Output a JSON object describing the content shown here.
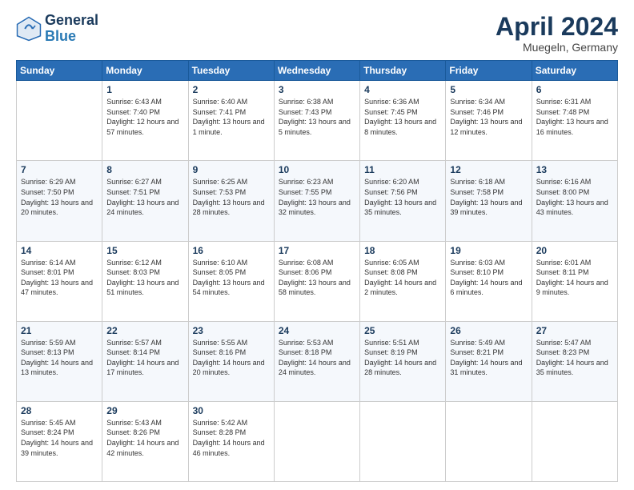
{
  "header": {
    "logo_line1": "General",
    "logo_line2": "Blue",
    "title": "April 2024",
    "subtitle": "Muegeln, Germany"
  },
  "weekdays": [
    "Sunday",
    "Monday",
    "Tuesday",
    "Wednesday",
    "Thursday",
    "Friday",
    "Saturday"
  ],
  "weeks": [
    [
      {
        "day": "",
        "info": ""
      },
      {
        "day": "1",
        "info": "Sunrise: 6:43 AM\nSunset: 7:40 PM\nDaylight: 12 hours\nand 57 minutes."
      },
      {
        "day": "2",
        "info": "Sunrise: 6:40 AM\nSunset: 7:41 PM\nDaylight: 13 hours\nand 1 minute."
      },
      {
        "day": "3",
        "info": "Sunrise: 6:38 AM\nSunset: 7:43 PM\nDaylight: 13 hours\nand 5 minutes."
      },
      {
        "day": "4",
        "info": "Sunrise: 6:36 AM\nSunset: 7:45 PM\nDaylight: 13 hours\nand 8 minutes."
      },
      {
        "day": "5",
        "info": "Sunrise: 6:34 AM\nSunset: 7:46 PM\nDaylight: 13 hours\nand 12 minutes."
      },
      {
        "day": "6",
        "info": "Sunrise: 6:31 AM\nSunset: 7:48 PM\nDaylight: 13 hours\nand 16 minutes."
      }
    ],
    [
      {
        "day": "7",
        "info": "Sunrise: 6:29 AM\nSunset: 7:50 PM\nDaylight: 13 hours\nand 20 minutes."
      },
      {
        "day": "8",
        "info": "Sunrise: 6:27 AM\nSunset: 7:51 PM\nDaylight: 13 hours\nand 24 minutes."
      },
      {
        "day": "9",
        "info": "Sunrise: 6:25 AM\nSunset: 7:53 PM\nDaylight: 13 hours\nand 28 minutes."
      },
      {
        "day": "10",
        "info": "Sunrise: 6:23 AM\nSunset: 7:55 PM\nDaylight: 13 hours\nand 32 minutes."
      },
      {
        "day": "11",
        "info": "Sunrise: 6:20 AM\nSunset: 7:56 PM\nDaylight: 13 hours\nand 35 minutes."
      },
      {
        "day": "12",
        "info": "Sunrise: 6:18 AM\nSunset: 7:58 PM\nDaylight: 13 hours\nand 39 minutes."
      },
      {
        "day": "13",
        "info": "Sunrise: 6:16 AM\nSunset: 8:00 PM\nDaylight: 13 hours\nand 43 minutes."
      }
    ],
    [
      {
        "day": "14",
        "info": "Sunrise: 6:14 AM\nSunset: 8:01 PM\nDaylight: 13 hours\nand 47 minutes."
      },
      {
        "day": "15",
        "info": "Sunrise: 6:12 AM\nSunset: 8:03 PM\nDaylight: 13 hours\nand 51 minutes."
      },
      {
        "day": "16",
        "info": "Sunrise: 6:10 AM\nSunset: 8:05 PM\nDaylight: 13 hours\nand 54 minutes."
      },
      {
        "day": "17",
        "info": "Sunrise: 6:08 AM\nSunset: 8:06 PM\nDaylight: 13 hours\nand 58 minutes."
      },
      {
        "day": "18",
        "info": "Sunrise: 6:05 AM\nSunset: 8:08 PM\nDaylight: 14 hours\nand 2 minutes."
      },
      {
        "day": "19",
        "info": "Sunrise: 6:03 AM\nSunset: 8:10 PM\nDaylight: 14 hours\nand 6 minutes."
      },
      {
        "day": "20",
        "info": "Sunrise: 6:01 AM\nSunset: 8:11 PM\nDaylight: 14 hours\nand 9 minutes."
      }
    ],
    [
      {
        "day": "21",
        "info": "Sunrise: 5:59 AM\nSunset: 8:13 PM\nDaylight: 14 hours\nand 13 minutes."
      },
      {
        "day": "22",
        "info": "Sunrise: 5:57 AM\nSunset: 8:14 PM\nDaylight: 14 hours\nand 17 minutes."
      },
      {
        "day": "23",
        "info": "Sunrise: 5:55 AM\nSunset: 8:16 PM\nDaylight: 14 hours\nand 20 minutes."
      },
      {
        "day": "24",
        "info": "Sunrise: 5:53 AM\nSunset: 8:18 PM\nDaylight: 14 hours\nand 24 minutes."
      },
      {
        "day": "25",
        "info": "Sunrise: 5:51 AM\nSunset: 8:19 PM\nDaylight: 14 hours\nand 28 minutes."
      },
      {
        "day": "26",
        "info": "Sunrise: 5:49 AM\nSunset: 8:21 PM\nDaylight: 14 hours\nand 31 minutes."
      },
      {
        "day": "27",
        "info": "Sunrise: 5:47 AM\nSunset: 8:23 PM\nDaylight: 14 hours\nand 35 minutes."
      }
    ],
    [
      {
        "day": "28",
        "info": "Sunrise: 5:45 AM\nSunset: 8:24 PM\nDaylight: 14 hours\nand 39 minutes."
      },
      {
        "day": "29",
        "info": "Sunrise: 5:43 AM\nSunset: 8:26 PM\nDaylight: 14 hours\nand 42 minutes."
      },
      {
        "day": "30",
        "info": "Sunrise: 5:42 AM\nSunset: 8:28 PM\nDaylight: 14 hours\nand 46 minutes."
      },
      {
        "day": "",
        "info": ""
      },
      {
        "day": "",
        "info": ""
      },
      {
        "day": "",
        "info": ""
      },
      {
        "day": "",
        "info": ""
      }
    ]
  ]
}
